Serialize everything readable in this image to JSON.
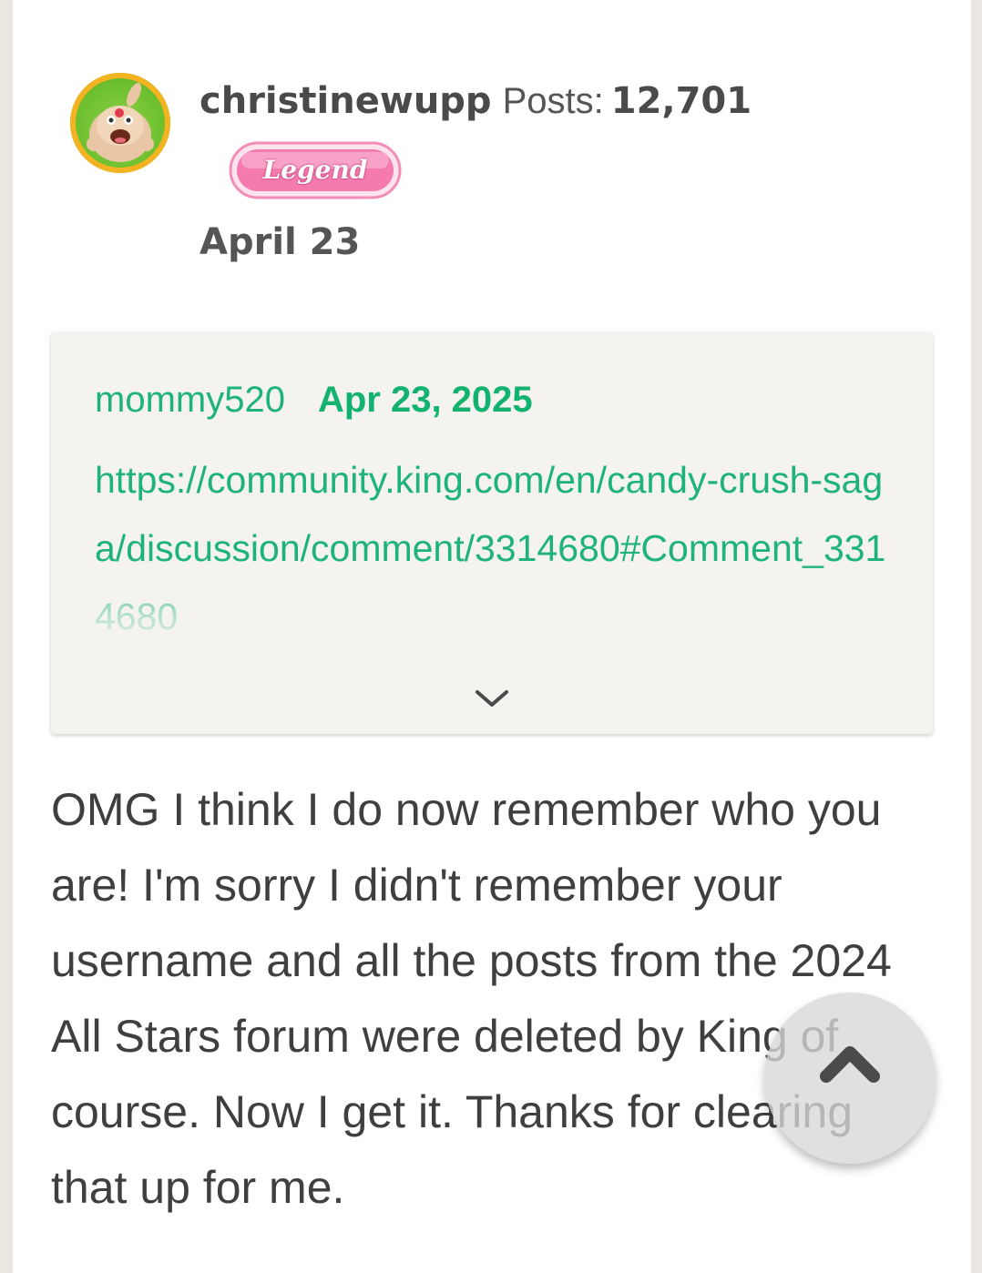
{
  "post": {
    "username": "christinewupp",
    "posts_label": "Posts:",
    "posts_count": "12,701",
    "badge": "Legend",
    "date": "April 23"
  },
  "quote": {
    "username": "mommy520",
    "date": "Apr 23, 2025",
    "body": "https://community.king.com/en/candy-crush-saga/discussion/comment/3314680#Comment_3314680"
  },
  "message": "OMG I think I do now remember who you are! I'm sorry I didn't remember your username and all the posts from the 2024 All Stars forum were deleted by King of course. Now I get it. Thanks for clearing that up for me.",
  "icons": {
    "expand": "chevron-down-icon",
    "scroll_top": "chevron-up-icon"
  },
  "colors": {
    "quote_link": "#1db37b",
    "badge_pink": "#f06fa6",
    "avatar_ring": "#f4b321"
  }
}
